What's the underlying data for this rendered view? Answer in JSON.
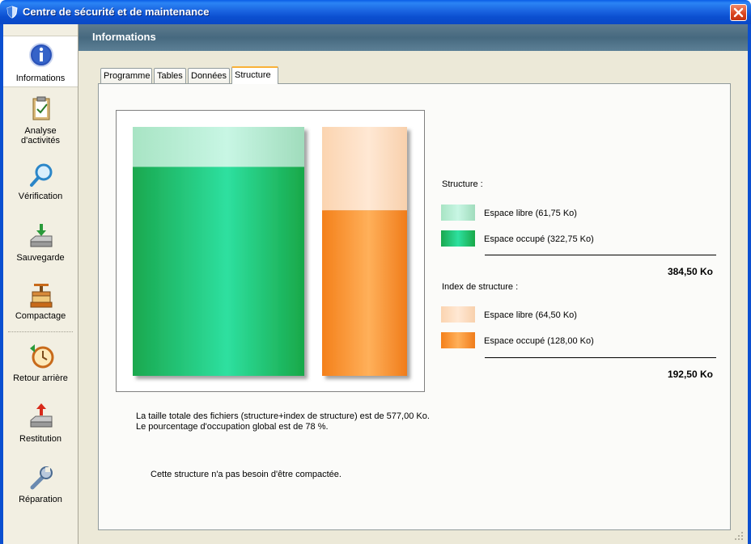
{
  "window": {
    "title": "Centre de sécurité et de maintenance",
    "accent": "#0b4fd0"
  },
  "sidebar": {
    "items": [
      {
        "label": "Informations",
        "icon": "info-icon",
        "active": true
      },
      {
        "label": "Analyse\nd'activités",
        "icon": "clipboard-icon",
        "active": false
      },
      {
        "label": "Vérification",
        "icon": "magnifier-icon",
        "active": false
      },
      {
        "label": "Sauvegarde",
        "icon": "backup-drive-icon",
        "active": false
      },
      {
        "label": "Compactage",
        "icon": "press-icon",
        "active": false
      },
      {
        "label": "Retour arrière",
        "icon": "clock-rollback-icon",
        "active": false
      },
      {
        "label": "Restitution",
        "icon": "restore-drive-icon",
        "active": false
      },
      {
        "label": "Réparation",
        "icon": "wrench-icon",
        "active": false
      }
    ]
  },
  "header": {
    "title": "Informations"
  },
  "tabs": [
    {
      "label": "Programme",
      "selected": false
    },
    {
      "label": "Tables",
      "selected": false
    },
    {
      "label": "Données",
      "selected": false
    },
    {
      "label": "Structure",
      "selected": true
    }
  ],
  "chart_data": {
    "type": "bar",
    "stacked": true,
    "series": [
      {
        "name": "Structure",
        "free": 61.75,
        "used": 322.75,
        "total": 384.5,
        "free_color": "#b8f0d8",
        "used_color": "#22c46a"
      },
      {
        "name": "Index de structure",
        "free": 64.5,
        "used": 128.0,
        "total": 192.5,
        "free_color": "#fde0c4",
        "used_color": "#f7902a"
      }
    ]
  },
  "legend": {
    "structure": {
      "heading": "Structure :",
      "free_label": "Espace libre (61,75 Ko)",
      "used_label": "Espace occupé (322,75 Ko)",
      "total": "384,50 Ko"
    },
    "index": {
      "heading": "Index de structure :",
      "free_label": "Espace libre (64,50 Ko)",
      "used_label": "Espace occupé (128,00 Ko)",
      "total": "192,50 Ko"
    }
  },
  "summary": {
    "line1": "La taille totale des fichiers (structure+index de structure) est de 577,00 Ko.",
    "line2": "Le pourcentage d'occupation global est de 78 %.",
    "status": "Cette structure n'a pas besoin d'être compactée."
  }
}
